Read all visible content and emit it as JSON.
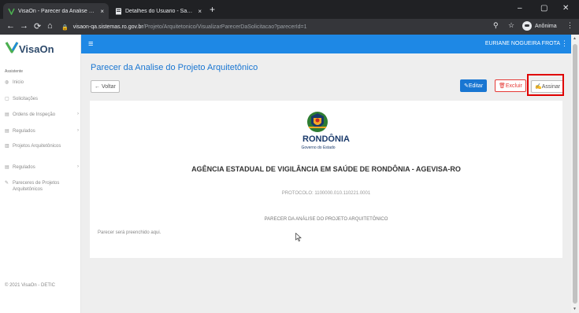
{
  "browser": {
    "tabs": [
      {
        "title": "VisaOn - Parecer da Analise do P",
        "active": true
      },
      {
        "title": "Detalhes do Usuario - Sauron.Gr",
        "active": false
      }
    ],
    "new_tab": "+",
    "close_glyph": "×",
    "window_controls": {
      "minimize": "–",
      "maximize": "▢",
      "close": "✕"
    },
    "nav": {
      "back": "←",
      "forward": "→",
      "reload": "⟳",
      "home": "⌂"
    },
    "url": {
      "host": "visaon-qa.sistemas.ro.gov.br",
      "path": "/Projeto/Arquitetonico/VisualizarParecerDaSolicitacao?parecerId=1"
    },
    "toolbar_icons": {
      "zoom": "⚲",
      "star": "☆",
      "menu": "⋮"
    },
    "incognito_label": "Anônima"
  },
  "app": {
    "logo_text": "VisaOn",
    "logo_color": "#4caf50",
    "brand_color": "#1e88e5",
    "user_name": "EURIANE NOGUEIRA FROTA",
    "user_menu_glyph": "⋮",
    "hamburger_glyph": "≡",
    "sidebar": {
      "section": "Assistente",
      "items": [
        {
          "label": "Inicio",
          "icon": "home-icon",
          "glyph": "◍",
          "arrow": ""
        },
        {
          "label": "Solicitações",
          "icon": "calendar-icon",
          "glyph": "▢",
          "arrow": ""
        },
        {
          "label": "Ordens de Inspeção",
          "icon": "document-icon",
          "glyph": "▤",
          "arrow": "›"
        },
        {
          "label": "Regulados",
          "icon": "document-icon",
          "glyph": "▤",
          "arrow": "›"
        },
        {
          "label": "Projetos Arquitetônicos",
          "icon": "building-icon",
          "glyph": "▥",
          "arrow": ""
        },
        {
          "label": "Regulados",
          "icon": "document-icon",
          "glyph": "▤",
          "arrow": "›"
        },
        {
          "label": "Pareceres de Projetos Arquitetônicos",
          "icon": "pen-icon",
          "glyph": "✎",
          "arrow": ""
        }
      ]
    },
    "page_title": "Parecer da Analise do Projeto Arquitetônico",
    "buttons": {
      "back": "← Voltar",
      "edit": "✎Editar",
      "delete": "🗑Excluir",
      "sign": "✍Assinar"
    },
    "document": {
      "state": "RONDÔNIA",
      "government": "Governo do Estado",
      "agency": "AGÊNCIA ESTADUAL DE VIGILÂNCIA EM SAÚDE DE RONDÔNIA - AGEVISA-RO",
      "protocol": "PROTOCOLO: 1100000.010.110221.0001",
      "title": "PARECER DA ANÁLISE DO PROJETO ARQUITETÔNICO",
      "placeholder": "Parecer será preenchido aqui."
    },
    "footer": "© 2021 VisaOn - DETIC",
    "annotation_color": "#e00000"
  }
}
